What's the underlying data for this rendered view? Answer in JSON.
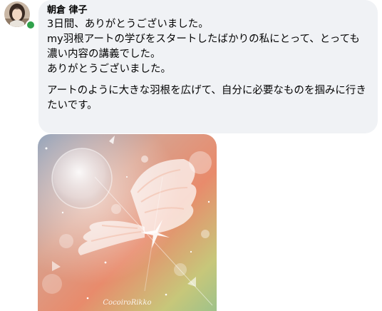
{
  "comment": {
    "author": "朝倉 律子",
    "online": true,
    "paragraphs": [
      "3日間、ありがとうございました。\nmy羽根アートの学びをスタートしたばかりの私にとって、とっても濃い内容の講義でした。\nありがとうございました。",
      "アートのように大きな羽根を広げて、自分に必要なものを掴みに行きたいです。"
    ],
    "attachment": {
      "watermark": "CocoiroRikko"
    }
  },
  "colors": {
    "bubble_bg": "#f0f2f5",
    "text": "#050505",
    "presence": "#31a24c"
  }
}
